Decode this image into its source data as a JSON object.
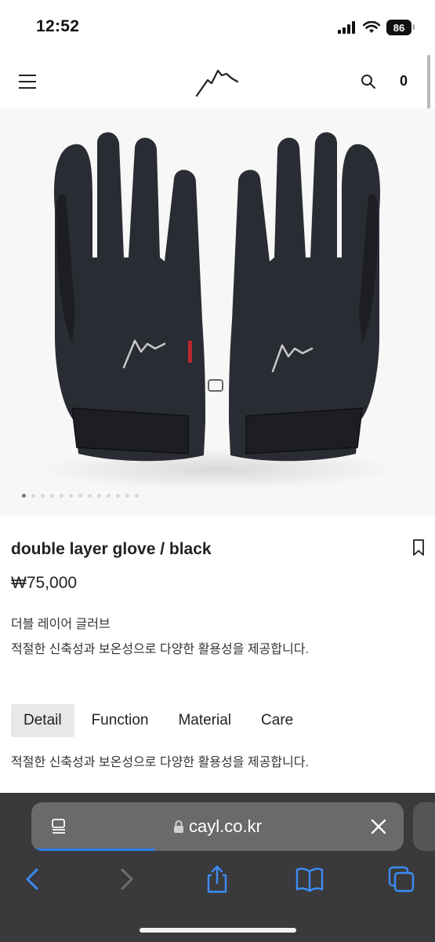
{
  "status_bar": {
    "time": "12:52",
    "battery": "86",
    "icons": [
      "cellular-signal-icon",
      "wifi-icon",
      "battery-icon"
    ]
  },
  "header": {
    "menu_icon": "hamburger-menu-icon",
    "logo_icon": "mountain-logo-icon",
    "search_icon": "search-icon",
    "cart_count": "0"
  },
  "product": {
    "image_icon": "gloves-photo",
    "gallery_total": 13,
    "gallery_active": 1,
    "title": "double layer glove / black",
    "price": "₩75,000",
    "bookmark_icon": "bookmark-icon",
    "description_title": "더블 레이어 글러브",
    "description_body": "적절한 신축성과 보온성으로 다양한 활용성을 제공합니다."
  },
  "tabs": {
    "items": [
      {
        "label": "Detail",
        "active": true
      },
      {
        "label": "Function",
        "active": false
      },
      {
        "label": "Material",
        "active": false
      },
      {
        "label": "Care",
        "active": false
      }
    ],
    "content": "적절한 신축성과 보온성으로 다양한 활용성을 제공합니다."
  },
  "browser": {
    "url": "cayl.co.kr",
    "lock_icon": "lock-icon",
    "page_menu_icon": "page-menu-icon",
    "clear_icon": "close-icon",
    "load_progress": 0.33,
    "nav_icons": [
      "back-icon",
      "forward-icon",
      "share-icon",
      "bookmarks-icon",
      "tabs-icon"
    ]
  },
  "colors": {
    "accent_blue": "#2f7cf6",
    "toolbar_bg": "#3a3a3c",
    "tab_active_bg": "#e8e8e8"
  }
}
